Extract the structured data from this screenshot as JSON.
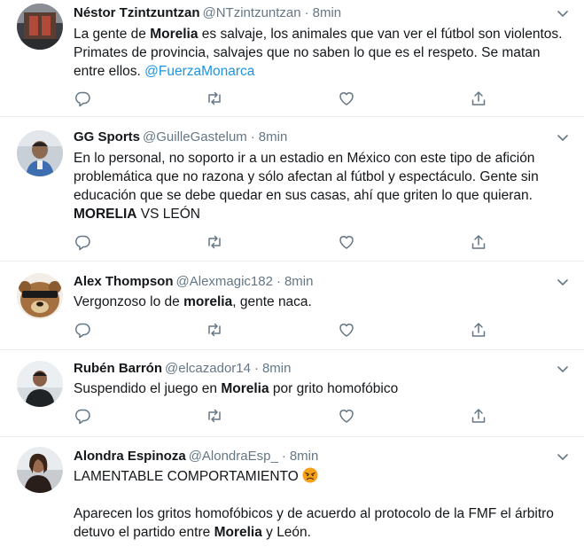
{
  "tweets": [
    {
      "name": "Néstor Tzintzuntzan",
      "handle": "@NTzintzuntzan",
      "separator": "·",
      "time": "8min",
      "paragraphs": [
        [
          {
            "text": "La gente de ",
            "style": "plain"
          },
          {
            "text": "Morelia",
            "style": "bold"
          },
          {
            "text": " es salvaje, los animales que van ver el fútbol son violentos. Primates de provincia, salvajes que no saben lo que es el respeto. Se matan entre ellos. ",
            "style": "plain"
          },
          {
            "text": "@FuerzaMonarca",
            "style": "mention"
          }
        ]
      ]
    },
    {
      "name": "GG Sports",
      "handle": "@GuilleGastelum",
      "separator": "·",
      "time": "8min",
      "paragraphs": [
        [
          {
            "text": "En lo personal, no soporto ir a un estadio en México con este tipo de afición problemática que no razona y sólo afectan al fútbol y espectáculo. Gente sin educación que se debe quedar en sus casas, ahí que griten lo que quieran. ",
            "style": "plain"
          },
          {
            "text": "MORELIA",
            "style": "bold"
          },
          {
            "text": " VS LEÓN",
            "style": "plain"
          }
        ]
      ]
    },
    {
      "name": "Alex Thompson",
      "handle": "@Alexmagic182",
      "separator": "·",
      "time": "8min",
      "paragraphs": [
        [
          {
            "text": "Vergonzoso lo de ",
            "style": "plain"
          },
          {
            "text": "morelia",
            "style": "bold"
          },
          {
            "text": ", gente naca.",
            "style": "plain"
          }
        ]
      ]
    },
    {
      "name": "Rubén Barrón",
      "handle": "@elcazador14",
      "separator": "·",
      "time": "8min",
      "paragraphs": [
        [
          {
            "text": "Suspendido el juego en ",
            "style": "plain"
          },
          {
            "text": "Morelia",
            "style": "bold"
          },
          {
            "text": " por grito homofóbico",
            "style": "plain"
          }
        ]
      ]
    },
    {
      "name": "Alondra Espinoza",
      "handle": "@AlondraEsp_",
      "separator": "·",
      "time": "8min",
      "paragraphs": [
        [
          {
            "text": "LAMENTABLE COMPORTAMIENTO",
            "style": "plain"
          },
          {
            "text": "",
            "style": "emoji-angry"
          }
        ],
        [
          {
            "text": "Aparecen los gritos homofóbicos y de acuerdo al protocolo de la FMF el árbitro detuvo el partido entre ",
            "style": "plain"
          },
          {
            "text": "Morelia",
            "style": "bold"
          },
          {
            "text": " y León.",
            "style": "plain"
          }
        ]
      ]
    }
  ],
  "colors": {
    "text": "#14171a",
    "secondary": "#657786",
    "link": "#1b95e0",
    "divider": "#e6ecf0"
  },
  "icons": {
    "reply": "reply-icon",
    "retweet": "retweet-icon",
    "like": "heart-icon",
    "share": "share-icon",
    "more": "chevron-down-icon"
  }
}
